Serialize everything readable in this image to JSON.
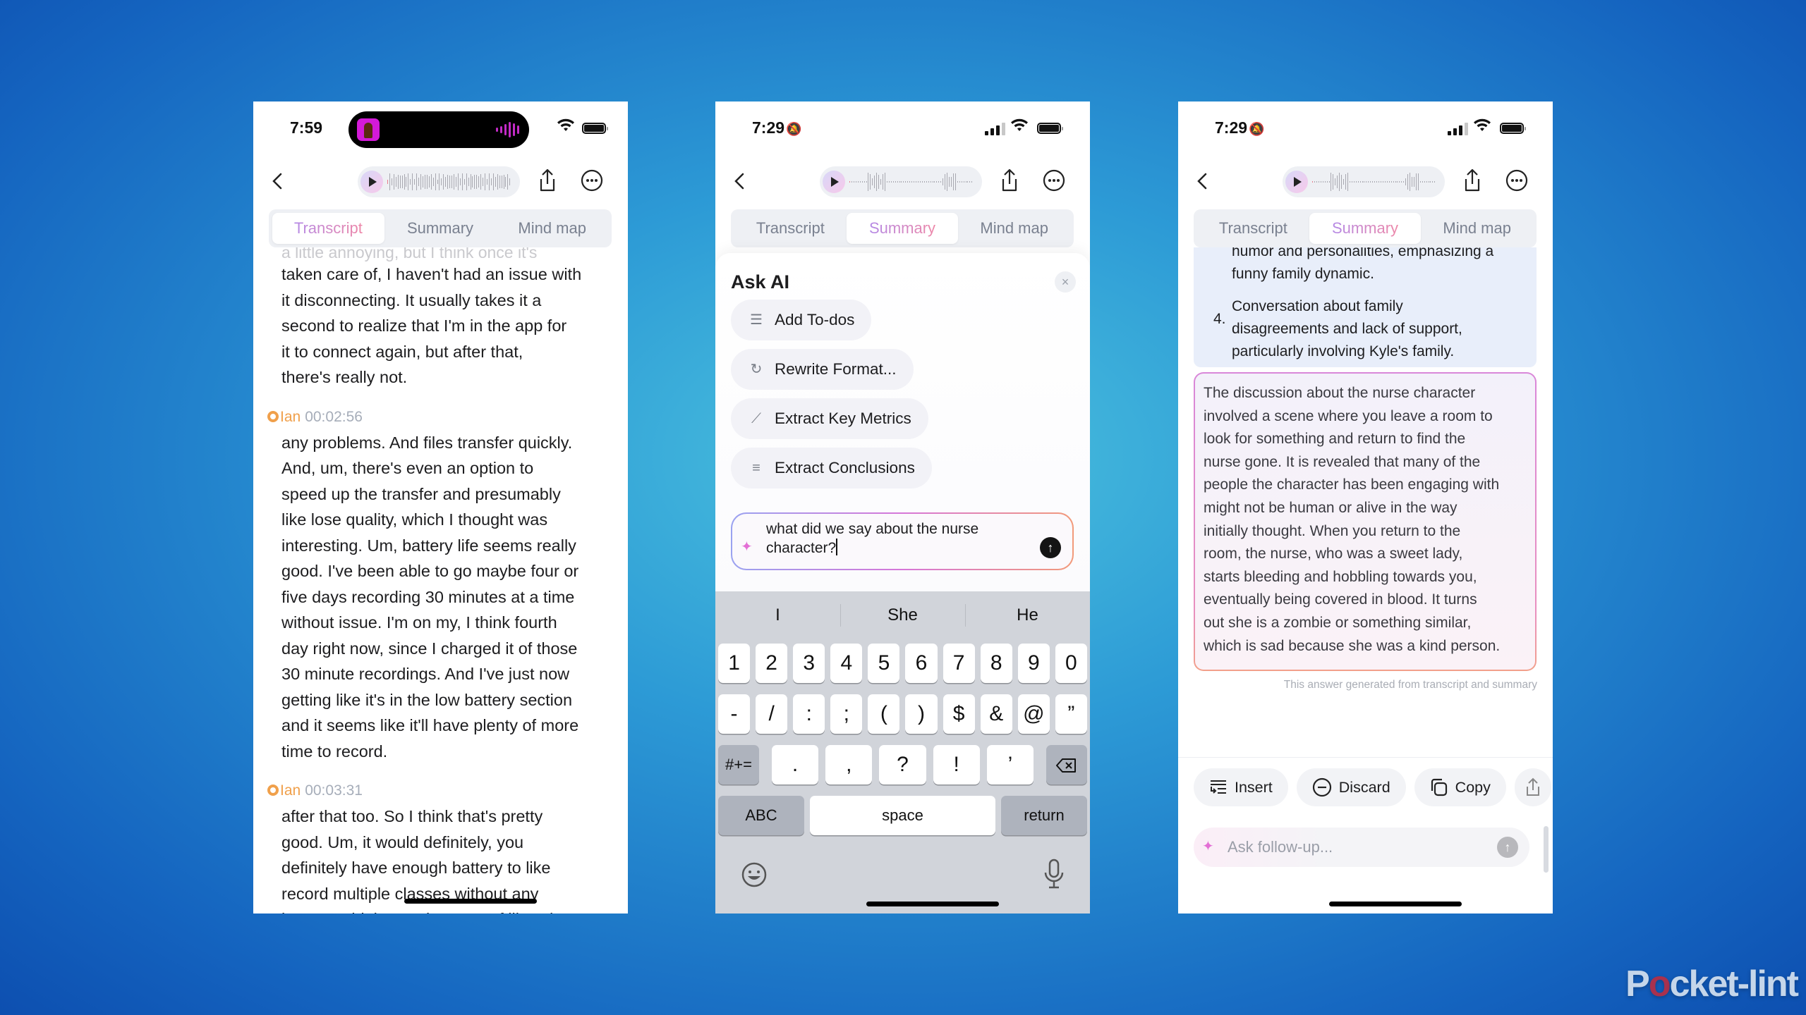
{
  "phone1": {
    "status": {
      "time": "7:59"
    },
    "tabs": [
      "Transcript",
      "Summary",
      "Mind map"
    ],
    "active_tab": "Transcript",
    "faded_line": "a little annoying, but I think once it's",
    "segments": [
      {
        "lines": [
          "taken care of, I haven't had an issue with",
          "it disconnecting. It usually takes it a",
          "second to realize that I'm in the app for",
          "it to connect again, but after that,",
          "there's really not."
        ]
      },
      {
        "speaker": "Ian",
        "timestamp": "00:02:56",
        "lines": [
          "any problems. And files transfer quickly.",
          "And, um, there's even an option to",
          "speed up the transfer and presumably",
          "like lose quality, which I thought was",
          "interesting. Um, battery life seems really",
          "good. I've been able to go maybe four or",
          "five days recording 30 minutes at a time",
          "without issue. I'm on my, I think fourth",
          "day right now, since I charged it of those",
          "30 minute recordings. And I've just now",
          "getting like it's in the low battery section",
          "and it seems like it'll have plenty of more",
          "time to record."
        ]
      },
      {
        "speaker": "Ian",
        "timestamp": "00:03:31",
        "lines": [
          "after that too. So I think that's pretty",
          "good. Um, it would definitely, you",
          "definitely have enough battery to like",
          "record multiple classes without any",
          "issues. I think. Um, in terms of like what"
        ]
      }
    ]
  },
  "phone2": {
    "status": {
      "time": "7:29"
    },
    "tabs": [
      "Transcript",
      "Summary",
      "Mind map"
    ],
    "active_tab": "Summary",
    "ask_ai": {
      "title": "Ask AI",
      "close": "×",
      "chips": [
        {
          "icon": "todo-list-icon",
          "label": "Add To-dos"
        },
        {
          "icon": "rewrite-icon",
          "label": "Rewrite Format..."
        },
        {
          "icon": "chart-line-icon",
          "label": "Extract Key Metrics"
        },
        {
          "icon": "list-icon",
          "label": "Extract Conclusions"
        }
      ],
      "input_value": "what did we say about the nurse character?"
    },
    "keyboard": {
      "suggestions": [
        "I",
        "She",
        "He"
      ],
      "row1": [
        "1",
        "2",
        "3",
        "4",
        "5",
        "6",
        "7",
        "8",
        "9",
        "0"
      ],
      "row2": [
        "-",
        "/",
        ":",
        ";",
        "(",
        ")",
        "$",
        "&",
        "@",
        "”"
      ],
      "row3": [
        ".",
        ",",
        "?",
        "!",
        "’"
      ],
      "symbols_key": "#+=",
      "abc_key": "ABC",
      "space_key": "space",
      "return_key": "return"
    }
  },
  "phone3": {
    "status": {
      "time": "7:29"
    },
    "tabs": [
      "Transcript",
      "Summary",
      "Mind map"
    ],
    "active_tab": "Summary",
    "summary": {
      "faded_line": "humor and personalities, emphasizing a",
      "item3_tail": "funny family dynamic.",
      "item4_number": "4.",
      "item4_lines": [
        "Conversation about family",
        "disagreements and lack of support,",
        "particularly involving Kyle's family."
      ]
    },
    "answer_lines": [
      "The discussion about the nurse character",
      "involved a scene where you leave a room to",
      "look for something and return to find the",
      "nurse gone. It is revealed that many of the",
      "people the character has been engaging with",
      "might not be human or alive in the way",
      "initially thought. When you return to the",
      "room, the nurse, who was a sweet lady,",
      "starts bleeding and hobbling towards you,",
      "eventually being covered in blood. It turns",
      "out she is a zombie or something similar,",
      "which is sad because she was a kind person."
    ],
    "disclaimer": "This answer generated from transcript and summary",
    "actions": [
      "Insert",
      "Discard",
      "Copy"
    ],
    "followup_placeholder": "Ask follow-up..."
  },
  "watermark": {
    "pre": "P",
    "o": "o",
    "post": "cket-lint"
  }
}
